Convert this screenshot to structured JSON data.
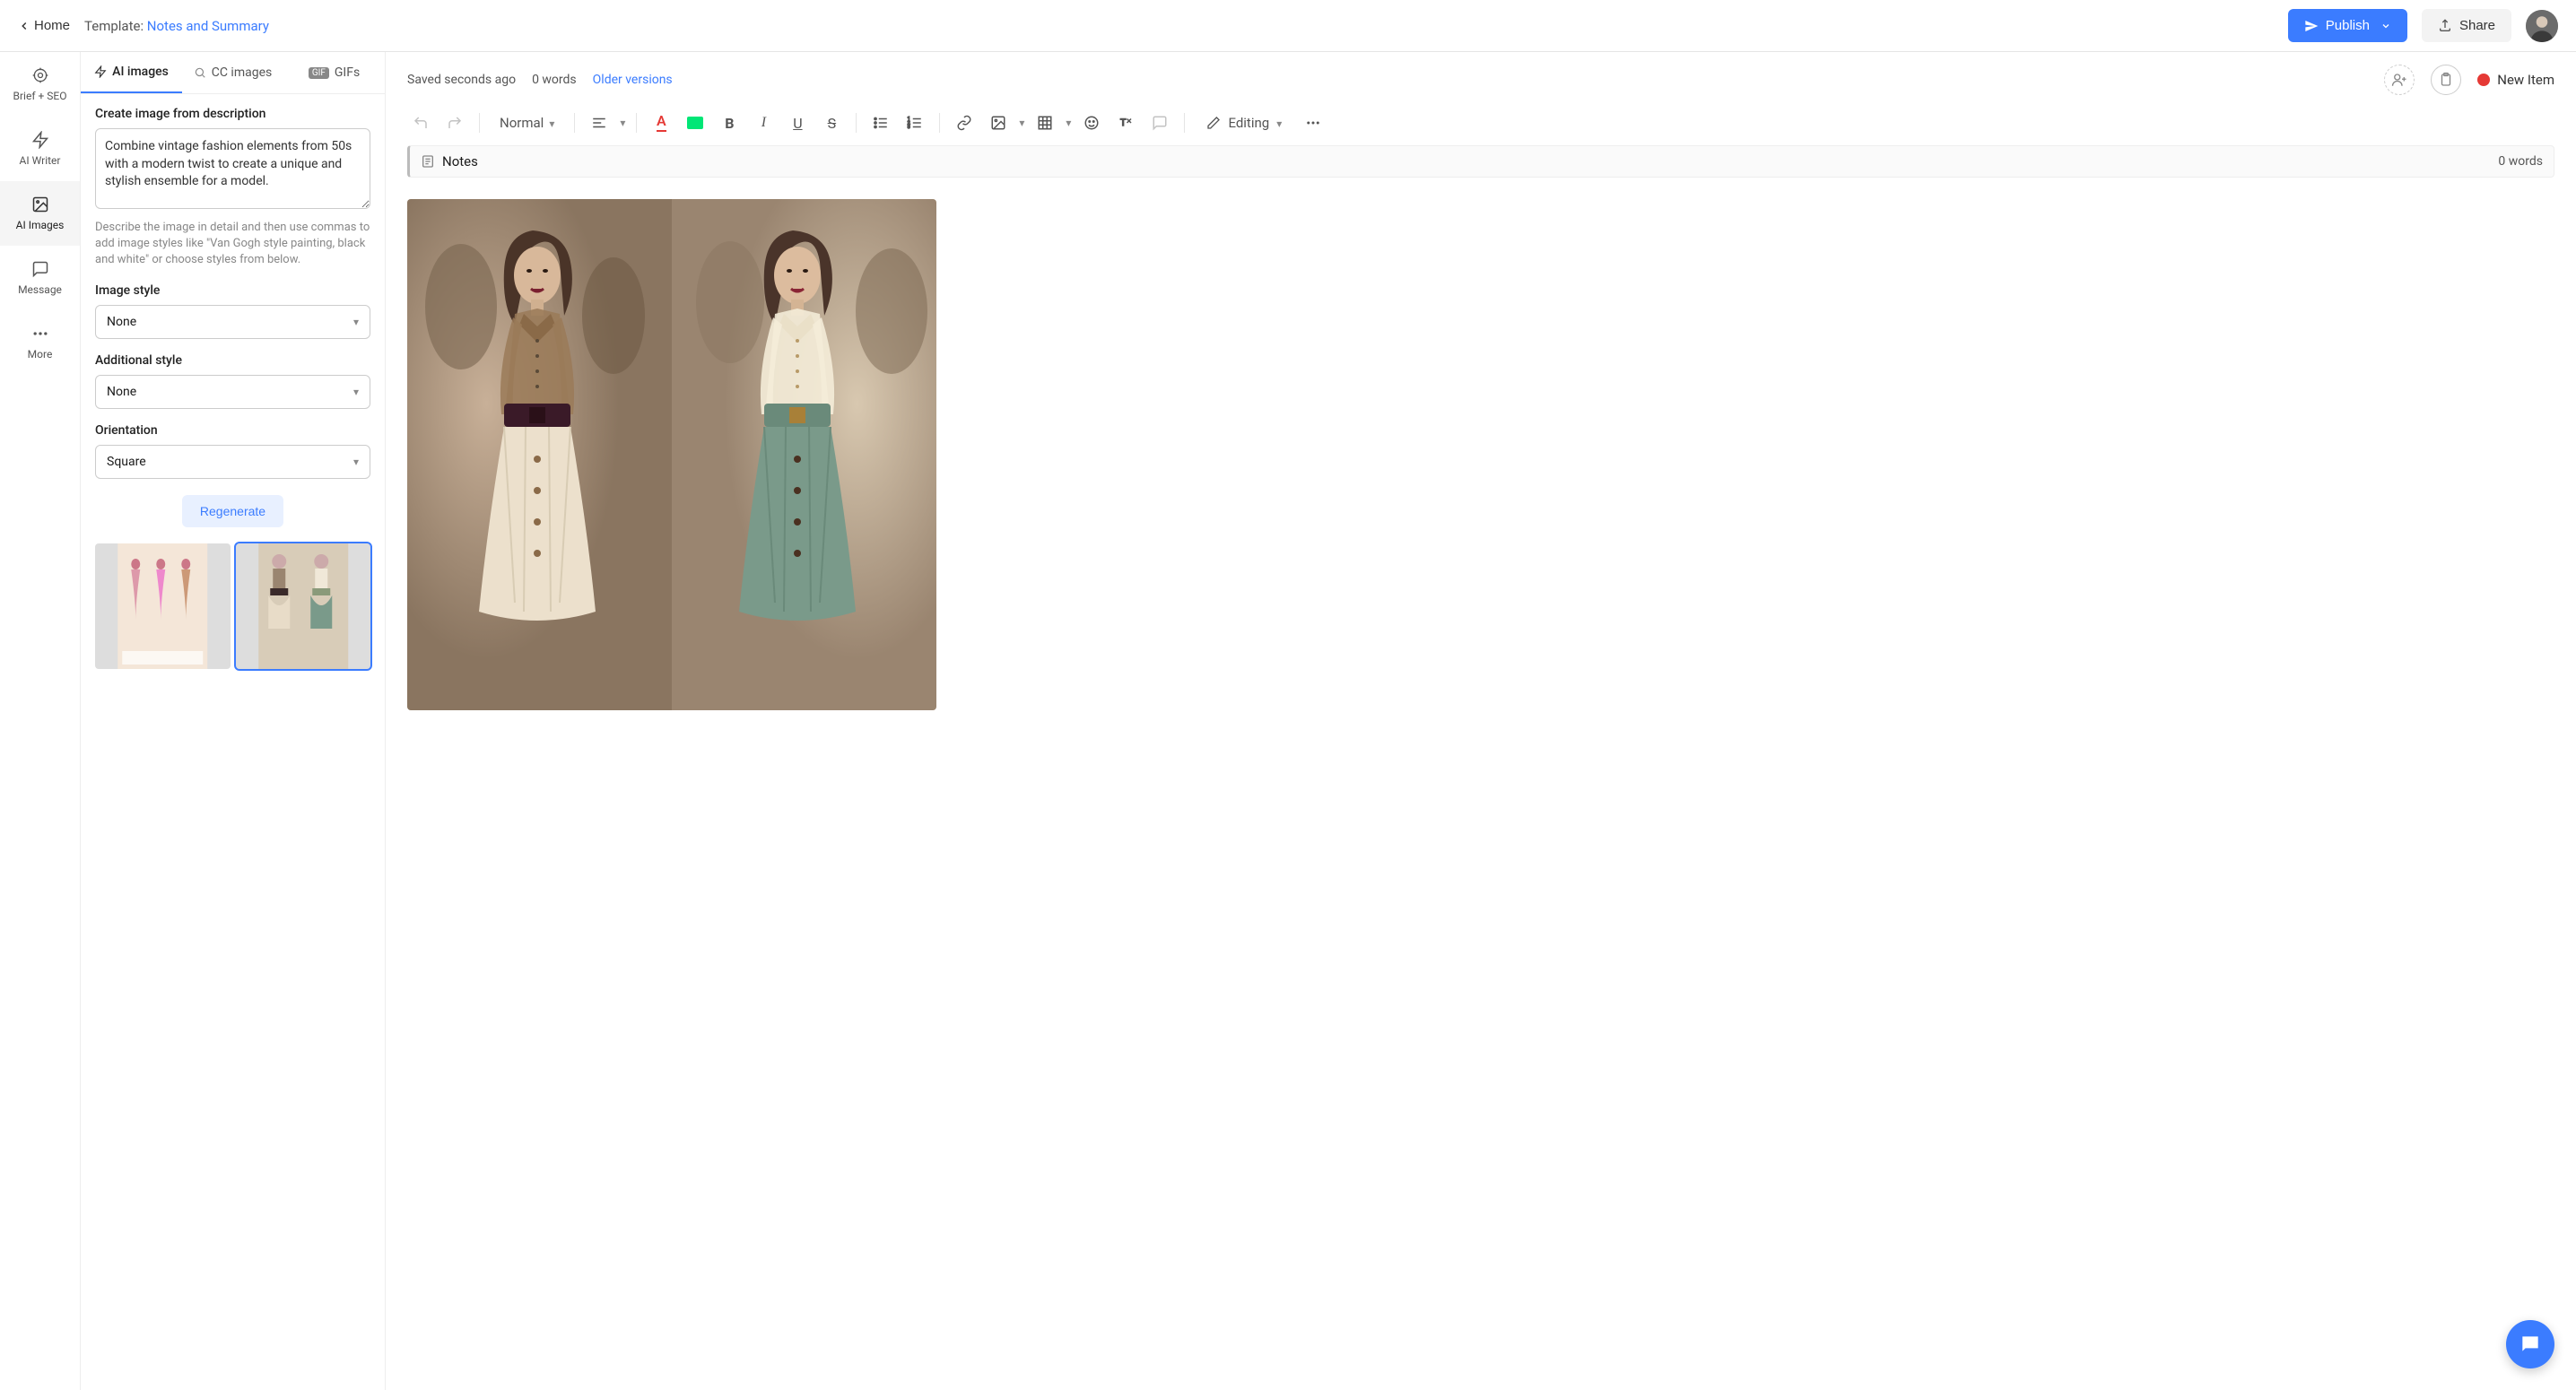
{
  "topbar": {
    "home": "Home",
    "template_prefix": "Template: ",
    "template_name": "Notes and Summary",
    "publish": "Publish",
    "share": "Share"
  },
  "rail": {
    "items": [
      {
        "label": "Brief + SEO"
      },
      {
        "label": "AI Writer"
      },
      {
        "label": "AI Images"
      },
      {
        "label": "Message"
      },
      {
        "label": "More"
      }
    ]
  },
  "panel": {
    "tabs": {
      "ai_images": "AI images",
      "cc_images": "CC images",
      "gifs": "GIFs"
    },
    "create_label": "Create image from description",
    "prompt_value": "Combine vintage fashion elements from 50s with a modern twist to create a unique and stylish ensemble for a model.",
    "help_text": "Describe the image in detail and then use commas to add image styles like \"Van Gogh style painting, black and white\" or choose styles from below.",
    "image_style_label": "Image style",
    "image_style_value": "None",
    "additional_style_label": "Additional style",
    "additional_style_value": "None",
    "orientation_label": "Orientation",
    "orientation_value": "Square",
    "regenerate": "Regenerate"
  },
  "editor": {
    "saved": "Saved seconds ago",
    "word_count_top": "0 words",
    "older_versions": "Older versions",
    "status": "New Item",
    "toolbar": {
      "paragraph_style": "Normal",
      "mode": "Editing"
    },
    "notes_title": "Notes",
    "notes_word_count": "0 words"
  },
  "colors": {
    "accent": "#3b7cff",
    "status_dot": "#e53935"
  }
}
